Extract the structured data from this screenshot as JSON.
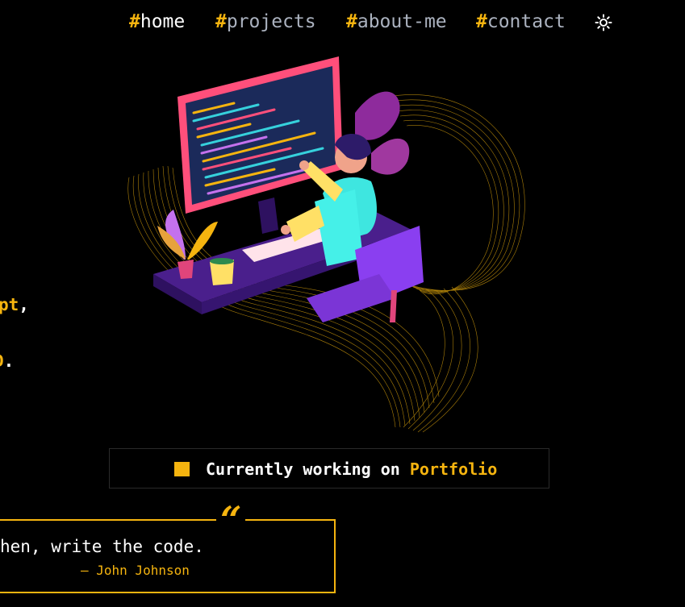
{
  "colors": {
    "background": "#000000",
    "accent": "#f5b40f",
    "nav_text": "#abb2bf",
    "active_text": "#ffffff"
  },
  "nav": {
    "items": [
      {
        "hash": "#",
        "label": "home",
        "active": true
      },
      {
        "hash": "#",
        "label": "projects",
        "active": false
      },
      {
        "hash": "#",
        "label": "about-me",
        "active": false
      },
      {
        "hash": "#",
        "label": "contact",
        "active": false
      }
    ],
    "theme_icon": "sun-icon"
  },
  "hero": {
    "line1_accent": "pt",
    "line1_rest": ",",
    "line2_accent": "D",
    "line2_rest": ".",
    "illustration": "developer-at-computer-illustration"
  },
  "status": {
    "prefix": "Currently working on ",
    "project": "Portfolio"
  },
  "quote": {
    "mark": "“",
    "text": "hen, write the code.",
    "author": "— John Johnson"
  }
}
